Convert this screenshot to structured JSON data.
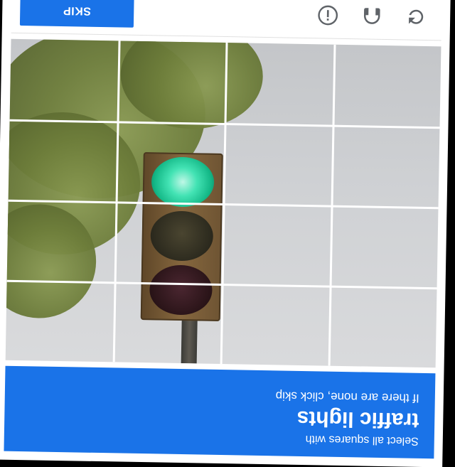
{
  "challenge": {
    "instruction_line1": "Select all squares with",
    "target_object": "traffic lights",
    "instruction_line3": "If there are none, click skip"
  },
  "grid": {
    "rows": 4,
    "columns": 4,
    "tiles": [
      {
        "row": 1,
        "col": 1
      },
      {
        "row": 1,
        "col": 2
      },
      {
        "row": 1,
        "col": 3
      },
      {
        "row": 1,
        "col": 4
      },
      {
        "row": 2,
        "col": 1
      },
      {
        "row": 2,
        "col": 2
      },
      {
        "row": 2,
        "col": 3
      },
      {
        "row": 2,
        "col": 4
      },
      {
        "row": 3,
        "col": 1
      },
      {
        "row": 3,
        "col": 2
      },
      {
        "row": 3,
        "col": 3
      },
      {
        "row": 3,
        "col": 4
      },
      {
        "row": 4,
        "col": 1
      },
      {
        "row": 4,
        "col": 2
      },
      {
        "row": 4,
        "col": 3
      },
      {
        "row": 4,
        "col": 4
      }
    ]
  },
  "footer": {
    "reload_icon": "reload-icon",
    "audio_icon": "headphones-icon",
    "info_icon": "info-icon",
    "skip_label": "SKIP"
  },
  "colors": {
    "accent": "#1a73e8",
    "icon": "#5f6368"
  }
}
